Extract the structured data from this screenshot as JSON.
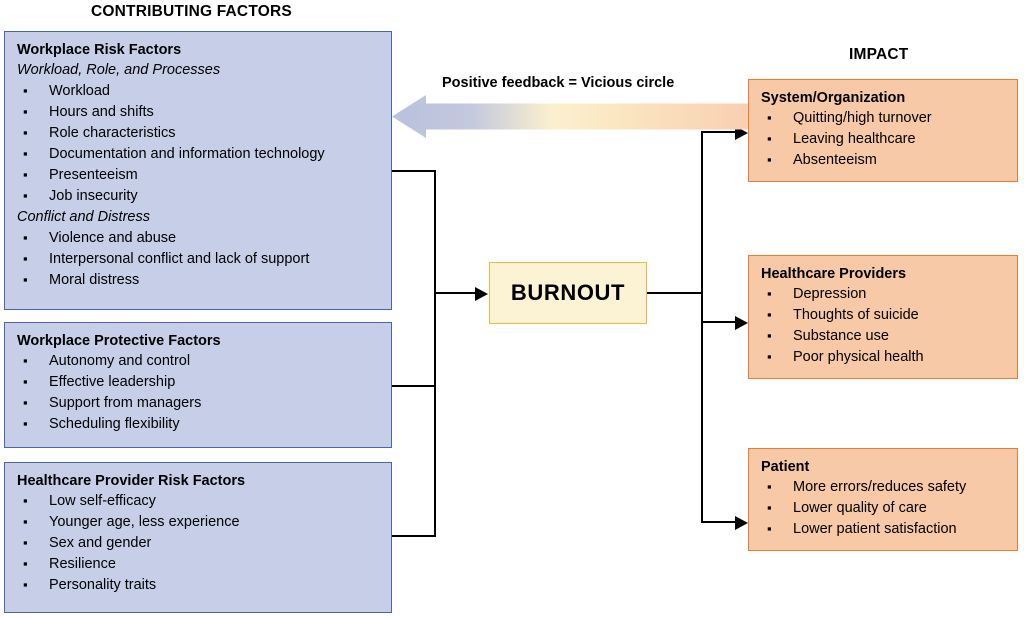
{
  "headers": {
    "contributing": "CONTRIBUTING FACTORS",
    "impact": "IMPACT"
  },
  "center": {
    "label": "BURNOUT"
  },
  "feedback": {
    "label": "Positive feedback = Vicious circle",
    "gradient_from": "#b9c1dd",
    "gradient_mid": "#fbf0cf",
    "gradient_to": "#f9cfb2"
  },
  "colors": {
    "blue_fill": "#c7cfe8",
    "blue_border": "#4a67a5",
    "orange_fill": "#f7c9a6",
    "orange_border": "#ec7c30",
    "burnout_fill": "#fcf2d4",
    "burnout_border": "#f2b73c",
    "connector": "#000000"
  },
  "contributing_boxes": [
    {
      "title": "Workplace Risk Factors",
      "groups": [
        {
          "subtitle": "Workload, Role, and Processes",
          "items": [
            "Workload",
            "Hours and shifts",
            "Role characteristics",
            "Documentation and information technology",
            "Presenteeism",
            "Job insecurity"
          ]
        },
        {
          "subtitle": "Conflict and Distress",
          "items": [
            "Violence and abuse",
            "Interpersonal conflict and lack of support",
            "Moral distress"
          ]
        }
      ]
    },
    {
      "title": "Workplace Protective Factors",
      "groups": [
        {
          "subtitle": "",
          "items": [
            "Autonomy and control",
            "Effective leadership",
            "Support from managers",
            "Scheduling flexibility"
          ]
        }
      ]
    },
    {
      "title": "Healthcare Provider Risk Factors",
      "groups": [
        {
          "subtitle": "",
          "items": [
            "Low self-efficacy",
            "Younger age, less experience",
            "Sex and gender",
            "Resilience",
            "Personality traits"
          ]
        }
      ]
    }
  ],
  "impact_boxes": [
    {
      "title": "System/Organization",
      "items": [
        "Quitting/high turnover",
        "Leaving healthcare",
        "Absenteeism"
      ]
    },
    {
      "title": "Healthcare Providers",
      "items": [
        "Depression",
        "Thoughts of suicide",
        "Substance use",
        "Poor physical health"
      ]
    },
    {
      "title": "Patient",
      "items": [
        "More errors/reduces safety",
        "Lower quality of care",
        "Lower patient satisfaction"
      ]
    }
  ]
}
